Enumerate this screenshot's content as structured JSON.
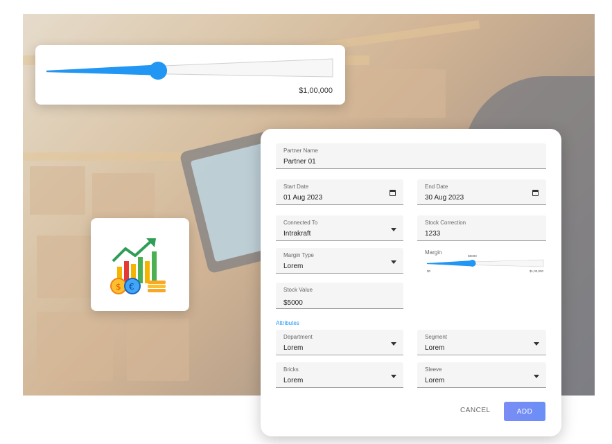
{
  "price_slider": {
    "value_label": "$1,00,000",
    "level": 0.39
  },
  "form": {
    "partner_name": {
      "label": "Partner Name",
      "value": "Partner 01"
    },
    "start_date": {
      "label": "Start Date",
      "value": "01 Aug 2023"
    },
    "end_date": {
      "label": "End Date",
      "value": "30 Aug 2023"
    },
    "connected_to": {
      "label": "Connected To",
      "value": "Intrakraft"
    },
    "stock_correction": {
      "label": "Stock Correction",
      "value": "1233"
    },
    "margin_type": {
      "label": "Margin Type",
      "value": "Lorem"
    },
    "margin": {
      "label": "Margin",
      "current": "$5000",
      "min": "$0",
      "max": "$1,00,000",
      "level": 0.39
    },
    "stock_value": {
      "label": "Stock Value",
      "value": "$5000"
    },
    "attributes_title": "Attributes",
    "department": {
      "label": "Department",
      "value": "Lorem"
    },
    "segment": {
      "label": "Segment",
      "value": "Lorem"
    },
    "bricks": {
      "label": "Bricks",
      "value": "Lorem"
    },
    "sleeve": {
      "label": "Sleeve",
      "value": "Lorem"
    },
    "cancel_label": "CANCEL",
    "add_label": "ADD"
  },
  "icons": {
    "growth": "growth-coins-icon",
    "calendar": "calendar-icon",
    "dropdown": "caret-down-icon"
  },
  "colors": {
    "accent": "#2196f3",
    "add_button": "#7b8cf5"
  }
}
